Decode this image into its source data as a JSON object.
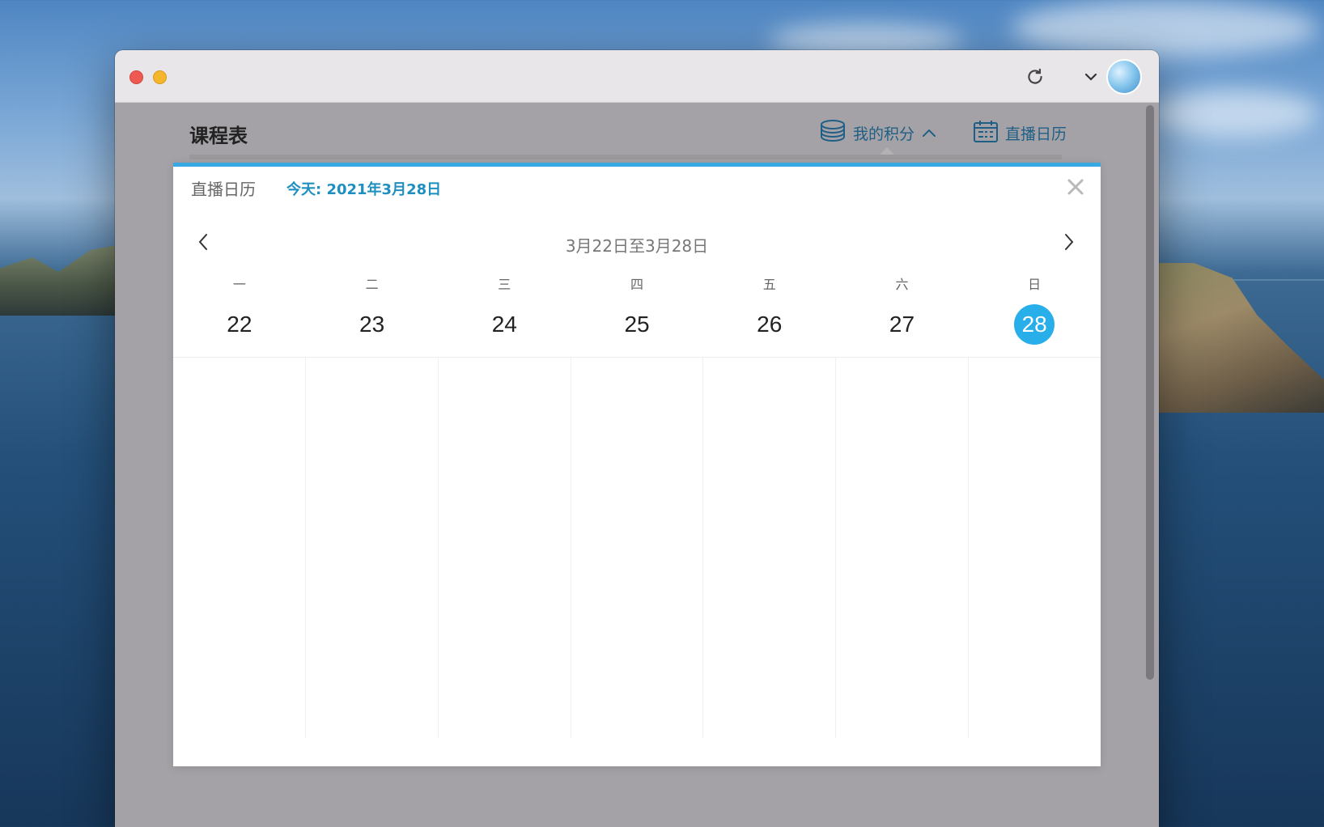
{
  "header": {
    "page_title": "课程表",
    "points_label": "我的积分",
    "live_calendar_label": "直播日历"
  },
  "panel": {
    "title": "直播日历",
    "today": "今天: 2021年3月28日",
    "week_range": "3月22日至3月28日",
    "days": [
      {
        "weekday": "一",
        "date": "22"
      },
      {
        "weekday": "二",
        "date": "23"
      },
      {
        "weekday": "三",
        "date": "24"
      },
      {
        "weekday": "四",
        "date": "25"
      },
      {
        "weekday": "五",
        "date": "26"
      },
      {
        "weekday": "六",
        "date": "27"
      },
      {
        "weekday": "日",
        "date": "28"
      }
    ],
    "selected_date": "28"
  },
  "icons": {
    "refresh": "refresh-icon",
    "dropdown": "chevron-down-icon",
    "points": "coins-stack-icon",
    "points_toggle": "chevron-up-icon",
    "calendar": "calendar-icon",
    "close": "close-icon",
    "prev": "chevron-left-icon",
    "next": "chevron-right-icon"
  },
  "colors": {
    "accent": "#28aee9",
    "link": "#1f5f86",
    "panel_top_border": "#39a9e3"
  }
}
